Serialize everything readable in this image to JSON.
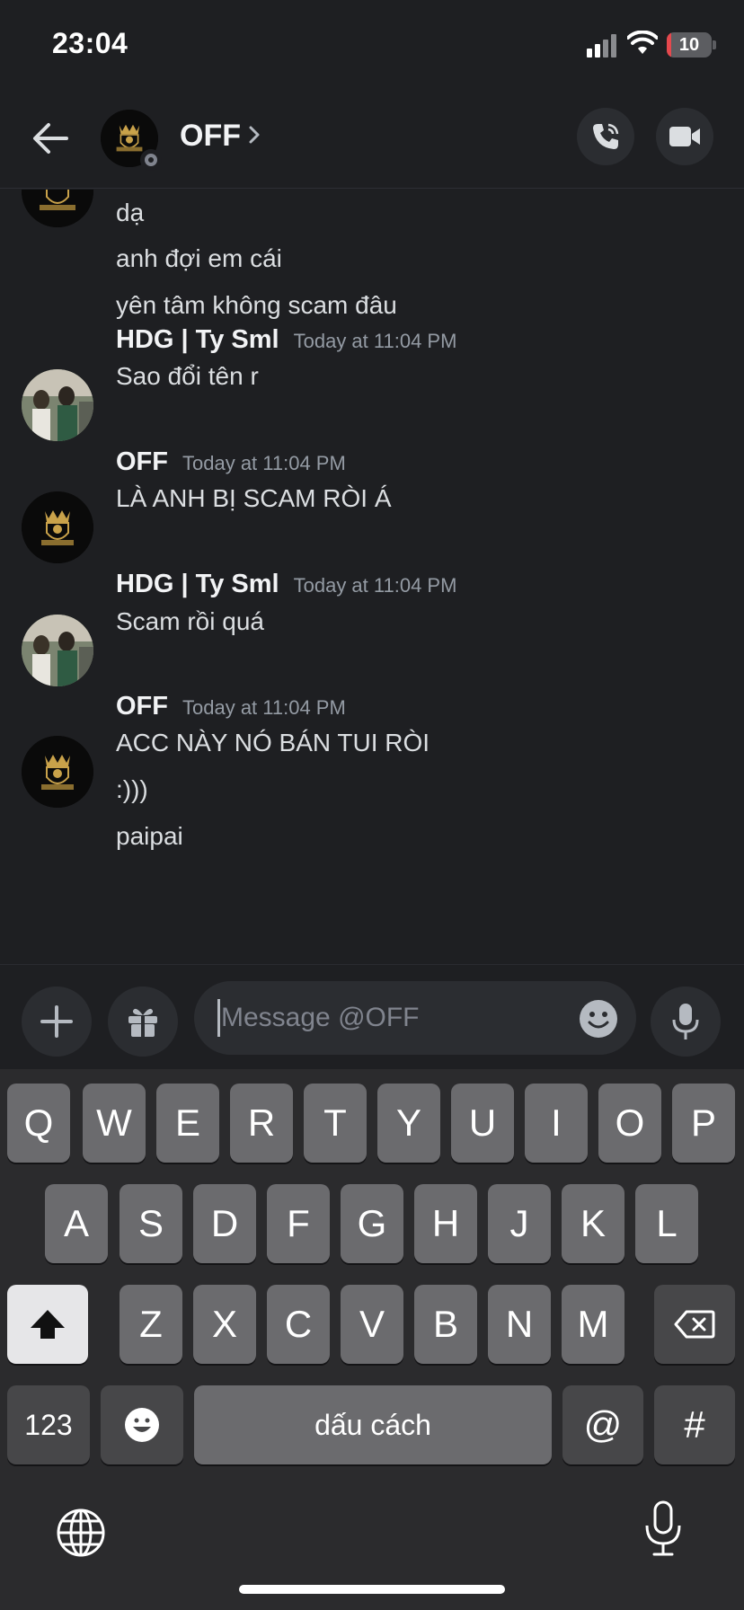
{
  "status_bar": {
    "time": "23:04",
    "battery": "10",
    "battery_level": 0.1,
    "battery_color": "#e5484d"
  },
  "header": {
    "title": "OFF"
  },
  "messages": {
    "top_lines": [
      "dạ",
      "anh đợi em cái",
      "yên tâm không scam đâu"
    ],
    "groups": [
      {
        "author": "HDG | Ty Sml",
        "time": "Today at 11:04 PM",
        "lines": [
          "Sao đổi tên r"
        ],
        "avatar": "photo"
      },
      {
        "author": "OFF",
        "time": "Today at 11:04 PM",
        "lines": [
          "LÀ ANH BỊ SCAM RÒI Á"
        ],
        "avatar": "lion-king"
      },
      {
        "author": "HDG | Ty Sml",
        "time": "Today at 11:04 PM",
        "lines": [
          "Scam rồi quá"
        ],
        "avatar": "photo"
      },
      {
        "author": "OFF",
        "time": "Today at 11:04 PM",
        "lines": [
          "ACC NÀY NÓ BÁN TUI RÒI",
          ":)))",
          "paipai"
        ],
        "avatar": "lion-king"
      }
    ]
  },
  "composer": {
    "placeholder": "Message @OFF"
  },
  "keyboard": {
    "row1": [
      "Q",
      "W",
      "E",
      "R",
      "T",
      "Y",
      "U",
      "I",
      "O",
      "P"
    ],
    "row2": [
      "A",
      "S",
      "D",
      "F",
      "G",
      "H",
      "J",
      "K",
      "L"
    ],
    "row3": [
      "Z",
      "X",
      "C",
      "V",
      "B",
      "N",
      "M"
    ],
    "numbers": "123",
    "space": "dấu cách",
    "at": "@",
    "hash": "#"
  },
  "accent": {
    "background": "#1e1f22",
    "surface": "#2b2d31",
    "muted": "#949ba4"
  }
}
